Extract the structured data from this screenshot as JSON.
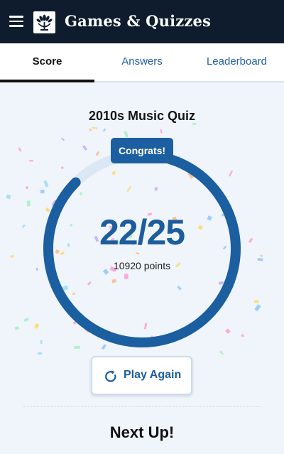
{
  "app": {
    "title": "Games & Quizzes"
  },
  "header": {
    "menu_icon": "hamburger-menu-icon",
    "logo_icon": "logo-icon"
  },
  "tabs": [
    {
      "label": "Score",
      "active": true
    },
    {
      "label": "Answers",
      "active": false
    },
    {
      "label": "Leaderboard",
      "active": false
    }
  ],
  "quiz": {
    "title": "2010s Music Quiz"
  },
  "result": {
    "badge": "Congrats!",
    "score_text": "22/25",
    "correct": 22,
    "total": 25,
    "points_text": "10920 points"
  },
  "actions": {
    "play_again_label": "Play Again",
    "play_again_icon": "refresh-icon"
  },
  "section": {
    "next_up_title": "Next Up!"
  },
  "colors": {
    "header_bg": "#0e1c2e",
    "accent": "#1c5fa0",
    "ring_track": "#dbe8f3",
    "background": "#eff5fa"
  }
}
